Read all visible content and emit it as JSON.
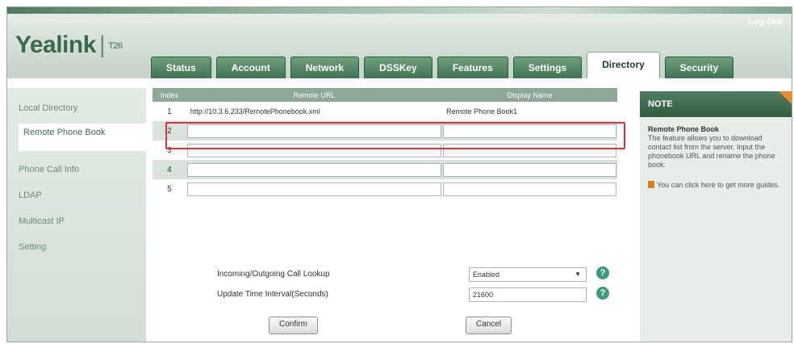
{
  "header": {
    "logo": "Yealink",
    "model": "T26",
    "logout": "Log Out"
  },
  "tabs": [
    {
      "label": "Status"
    },
    {
      "label": "Account"
    },
    {
      "label": "Network"
    },
    {
      "label": "DSSKey"
    },
    {
      "label": "Features"
    },
    {
      "label": "Settings"
    },
    {
      "label": "Directory",
      "active": true
    },
    {
      "label": "Security"
    }
  ],
  "sidebar": {
    "items": [
      {
        "label": "Local Directory"
      },
      {
        "label": "Remote Phone Book",
        "active": true
      },
      {
        "label": "Phone Call Info"
      },
      {
        "label": "LDAP"
      },
      {
        "label": "Multicast IP"
      },
      {
        "label": "Setting"
      }
    ]
  },
  "table": {
    "headers": [
      "Index",
      "Remote URL",
      "Display Name"
    ],
    "rows": [
      {
        "index": "1",
        "url": "http://10.3.6.233/RemotePhonebook.xml",
        "name": "Remote Phone Book1"
      },
      {
        "index": "2",
        "url": "",
        "name": ""
      },
      {
        "index": "3",
        "url": "",
        "name": ""
      },
      {
        "index": "4",
        "url": "",
        "name": ""
      },
      {
        "index": "5",
        "url": "",
        "name": ""
      }
    ]
  },
  "form": {
    "lookup_label": "Incoming/Outgoing Call Lookup",
    "lookup_value": "Enabled",
    "interval_label": "Update Time Interval(Seconds)",
    "interval_value": "21600",
    "help_glyph": "?"
  },
  "buttons": {
    "confirm": "Confirm",
    "cancel": "Cancel"
  },
  "note": {
    "heading": "NOTE",
    "title": "Remote Phone Book",
    "body": "The feature allows you to download contact list from the server. Input the phonebook URL and rename the phone book.",
    "link": "You can click here to get more guides."
  },
  "colors": {
    "brand": "#3b6a4a",
    "highlight": "#d8323a",
    "note_accent": "#f08a2a"
  }
}
